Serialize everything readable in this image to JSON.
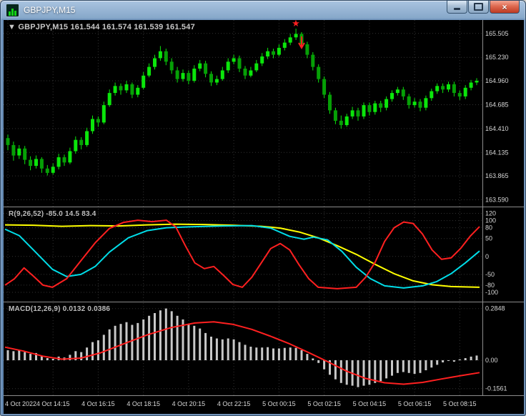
{
  "window": {
    "title": "GBPJPY,M15",
    "close_glyph": "×"
  },
  "colors": {
    "background": "#000000",
    "grid": "#333333",
    "separator": "#8c8c8c",
    "axis_text": "#d8d8d8",
    "bull": "#0be60b",
    "bear": "#06a006",
    "wick": "#0be60b",
    "marker": "#ff2020"
  },
  "chart_data": [
    {
      "type": "candlestick",
      "title": "GBPJPY,M15",
      "ohlc_label": "▼ GBPJPY,M15 161.544 161.574 161.539 161.547",
      "ylim": [
        163.52,
        165.66
      ],
      "y_ticks": [
        "165.505",
        "165.230",
        "164.960",
        "164.685",
        "164.410",
        "164.135",
        "163.865",
        "163.590"
      ],
      "x_ticks": [
        {
          "i": 0,
          "label": "4 Oct 2022"
        },
        {
          "i": 8,
          "label": "4 Oct 14:15"
        },
        {
          "i": 16,
          "label": "4 Oct 16:15"
        },
        {
          "i": 24,
          "label": "4 Oct 18:15"
        },
        {
          "i": 32,
          "label": "4 Oct 20:15"
        },
        {
          "i": 40,
          "label": "4 Oct 22:15"
        },
        {
          "i": 48,
          "label": "5 Oct 00:15"
        },
        {
          "i": 56,
          "label": "5 Oct 02:15"
        },
        {
          "i": 64,
          "label": "5 Oct 04:15"
        },
        {
          "i": 72,
          "label": "5 Oct 06:15"
        },
        {
          "i": 80,
          "label": "5 Oct 08:15"
        }
      ],
      "markers": [
        {
          "index": 51,
          "type": "star"
        },
        {
          "index": 52,
          "type": "arrow-down"
        }
      ],
      "candles": [
        [
          164.3,
          164.34,
          164.16,
          164.22
        ],
        [
          164.22,
          164.26,
          164.04,
          164.1
        ],
        [
          164.1,
          164.22,
          164.06,
          164.18
        ],
        [
          164.18,
          164.21,
          164.0,
          164.05
        ],
        [
          164.05,
          164.09,
          163.93,
          163.98
        ],
        [
          163.98,
          164.1,
          163.95,
          164.06
        ],
        [
          164.06,
          164.08,
          163.9,
          163.95
        ],
        [
          163.95,
          163.99,
          163.87,
          163.9
        ],
        [
          163.9,
          164.01,
          163.88,
          163.97
        ],
        [
          163.97,
          164.12,
          163.94,
          164.08
        ],
        [
          164.08,
          164.11,
          163.98,
          164.02
        ],
        [
          164.02,
          164.19,
          164.0,
          164.15
        ],
        [
          164.15,
          164.32,
          164.12,
          164.28
        ],
        [
          164.28,
          164.31,
          164.17,
          164.22
        ],
        [
          164.22,
          164.42,
          164.2,
          164.38
        ],
        [
          164.38,
          164.56,
          164.35,
          164.52
        ],
        [
          164.52,
          164.55,
          164.43,
          164.48
        ],
        [
          164.48,
          164.72,
          164.46,
          164.68
        ],
        [
          164.68,
          164.86,
          164.66,
          164.82
        ],
        [
          164.82,
          164.94,
          164.79,
          164.9
        ],
        [
          164.9,
          164.93,
          164.8,
          164.85
        ],
        [
          164.85,
          164.96,
          164.82,
          164.92
        ],
        [
          164.92,
          164.94,
          164.76,
          164.8
        ],
        [
          164.8,
          164.91,
          164.77,
          164.88
        ],
        [
          164.88,
          165.06,
          164.86,
          165.02
        ],
        [
          165.02,
          165.16,
          165.0,
          165.12
        ],
        [
          165.12,
          165.26,
          165.09,
          165.22
        ],
        [
          165.22,
          165.36,
          165.19,
          165.3
        ],
        [
          165.3,
          165.33,
          165.14,
          165.18
        ],
        [
          165.18,
          165.22,
          165.04,
          165.08
        ],
        [
          165.08,
          165.12,
          164.94,
          164.98
        ],
        [
          164.98,
          165.09,
          164.95,
          165.05
        ],
        [
          165.05,
          165.08,
          164.92,
          164.96
        ],
        [
          164.96,
          165.14,
          164.94,
          165.1
        ],
        [
          165.1,
          165.2,
          165.07,
          165.16
        ],
        [
          165.16,
          165.19,
          165.0,
          165.04
        ],
        [
          165.04,
          165.07,
          164.9,
          164.94
        ],
        [
          164.94,
          165.02,
          164.91,
          164.98
        ],
        [
          164.98,
          165.12,
          164.96,
          165.08
        ],
        [
          165.08,
          165.22,
          165.05,
          165.18
        ],
        [
          165.18,
          165.26,
          165.15,
          165.22
        ],
        [
          165.22,
          165.25,
          165.06,
          165.1
        ],
        [
          165.1,
          165.13,
          164.98,
          165.02
        ],
        [
          165.02,
          165.12,
          165.0,
          165.08
        ],
        [
          165.08,
          165.2,
          165.06,
          165.16
        ],
        [
          165.16,
          165.28,
          165.13,
          165.24
        ],
        [
          165.24,
          165.34,
          165.21,
          165.3
        ],
        [
          165.3,
          165.33,
          165.22,
          165.26
        ],
        [
          165.26,
          165.38,
          165.24,
          165.34
        ],
        [
          165.34,
          165.44,
          165.31,
          165.4
        ],
        [
          165.4,
          165.5,
          165.37,
          165.46
        ],
        [
          165.46,
          165.56,
          165.43,
          165.5
        ],
        [
          165.5,
          165.52,
          165.34,
          165.38
        ],
        [
          165.38,
          165.41,
          165.22,
          165.26
        ],
        [
          165.26,
          165.29,
          165.08,
          165.12
        ],
        [
          165.12,
          165.15,
          164.94,
          164.98
        ],
        [
          164.98,
          165.01,
          164.76,
          164.8
        ],
        [
          164.8,
          164.83,
          164.58,
          164.62
        ],
        [
          164.62,
          164.65,
          164.46,
          164.5
        ],
        [
          164.5,
          164.56,
          164.41,
          164.45
        ],
        [
          164.45,
          164.58,
          164.43,
          164.55
        ],
        [
          164.55,
          164.66,
          164.52,
          164.62
        ],
        [
          164.62,
          164.65,
          164.5,
          164.55
        ],
        [
          164.55,
          164.71,
          164.52,
          164.68
        ],
        [
          164.68,
          164.71,
          164.56,
          164.6
        ],
        [
          164.6,
          164.73,
          164.57,
          164.7
        ],
        [
          164.7,
          164.73,
          164.6,
          164.65
        ],
        [
          164.65,
          164.78,
          164.62,
          164.75
        ],
        [
          164.75,
          164.85,
          164.72,
          164.82
        ],
        [
          164.82,
          164.89,
          164.79,
          164.86
        ],
        [
          164.86,
          164.89,
          164.74,
          164.78
        ],
        [
          164.78,
          164.81,
          164.64,
          164.68
        ],
        [
          164.68,
          164.76,
          164.65,
          164.72
        ],
        [
          164.72,
          164.75,
          164.61,
          164.65
        ],
        [
          164.65,
          164.79,
          164.62,
          164.76
        ],
        [
          164.76,
          164.87,
          164.73,
          164.84
        ],
        [
          164.84,
          164.93,
          164.81,
          164.9
        ],
        [
          164.9,
          164.93,
          164.82,
          164.86
        ],
        [
          164.86,
          164.95,
          164.83,
          164.92
        ],
        [
          164.92,
          164.95,
          164.78,
          164.82
        ],
        [
          164.82,
          164.85,
          164.74,
          164.78
        ],
        [
          164.78,
          164.91,
          164.75,
          164.88
        ],
        [
          164.88,
          164.97,
          164.85,
          164.94
        ],
        [
          164.94,
          164.99,
          164.91,
          164.96
        ]
      ]
    },
    {
      "type": "line",
      "label": "R(9,26,52) -85.0 14.5 83.4",
      "ylim": [
        -122,
        135
      ],
      "y_ticks": [
        "120",
        "100",
        "80",
        "50",
        "0",
        "-50",
        "-80",
        "-100"
      ],
      "series": [
        {
          "name": "slow",
          "color": "#ffff00",
          "width": 2,
          "points": [
            [
              0,
              88
            ],
            [
              0.06,
              87
            ],
            [
              0.12,
              84
            ],
            [
              0.18,
              86
            ],
            [
              0.24,
              85
            ],
            [
              0.3,
              88
            ],
            [
              0.36,
              90
            ],
            [
              0.42,
              89
            ],
            [
              0.48,
              87
            ],
            [
              0.54,
              84
            ],
            [
              0.58,
              79
            ],
            [
              0.62,
              68
            ],
            [
              0.66,
              52
            ],
            [
              0.7,
              30
            ],
            [
              0.74,
              6
            ],
            [
              0.78,
              -22
            ],
            [
              0.82,
              -48
            ],
            [
              0.86,
              -68
            ],
            [
              0.9,
              -79
            ],
            [
              0.94,
              -84
            ],
            [
              1,
              -86
            ]
          ]
        },
        {
          "name": "mid",
          "color": "#00dde8",
          "width": 2,
          "points": [
            [
              0,
              76
            ],
            [
              0.03,
              58
            ],
            [
              0.06,
              18
            ],
            [
              0.1,
              -36
            ],
            [
              0.13,
              -56
            ],
            [
              0.16,
              -50
            ],
            [
              0.19,
              -28
            ],
            [
              0.22,
              12
            ],
            [
              0.26,
              52
            ],
            [
              0.3,
              72
            ],
            [
              0.34,
              80
            ],
            [
              0.4,
              83
            ],
            [
              0.46,
              85
            ],
            [
              0.52,
              86
            ],
            [
              0.56,
              79
            ],
            [
              0.6,
              56
            ],
            [
              0.63,
              48
            ],
            [
              0.65,
              54
            ],
            [
              0.68,
              46
            ],
            [
              0.71,
              14
            ],
            [
              0.74,
              -30
            ],
            [
              0.77,
              -62
            ],
            [
              0.8,
              -82
            ],
            [
              0.84,
              -88
            ],
            [
              0.88,
              -82
            ],
            [
              0.91,
              -70
            ],
            [
              0.94,
              -48
            ],
            [
              0.97,
              -18
            ],
            [
              1,
              15
            ]
          ]
        },
        {
          "name": "fast",
          "color": "#ff2020",
          "width": 2,
          "points": [
            [
              0,
              -80
            ],
            [
              0.02,
              -62
            ],
            [
              0.04,
              -32
            ],
            [
              0.06,
              -55
            ],
            [
              0.08,
              -80
            ],
            [
              0.1,
              -86
            ],
            [
              0.13,
              -62
            ],
            [
              0.16,
              -12
            ],
            [
              0.19,
              38
            ],
            [
              0.22,
              78
            ],
            [
              0.25,
              95
            ],
            [
              0.28,
              101
            ],
            [
              0.31,
              97
            ],
            [
              0.34,
              101
            ],
            [
              0.36,
              82
            ],
            [
              0.38,
              30
            ],
            [
              0.4,
              -18
            ],
            [
              0.42,
              -34
            ],
            [
              0.44,
              -28
            ],
            [
              0.46,
              -52
            ],
            [
              0.48,
              -78
            ],
            [
              0.5,
              -86
            ],
            [
              0.52,
              -58
            ],
            [
              0.54,
              -18
            ],
            [
              0.56,
              22
            ],
            [
              0.58,
              36
            ],
            [
              0.6,
              18
            ],
            [
              0.62,
              -24
            ],
            [
              0.64,
              -62
            ],
            [
              0.66,
              -86
            ],
            [
              0.7,
              -90
            ],
            [
              0.74,
              -86
            ],
            [
              0.76,
              -58
            ],
            [
              0.78,
              -16
            ],
            [
              0.8,
              42
            ],
            [
              0.82,
              80
            ],
            [
              0.84,
              96
            ],
            [
              0.86,
              92
            ],
            [
              0.88,
              62
            ],
            [
              0.9,
              18
            ],
            [
              0.92,
              -8
            ],
            [
              0.94,
              -4
            ],
            [
              0.96,
              22
            ],
            [
              0.98,
              56
            ],
            [
              1,
              83
            ]
          ]
        }
      ]
    },
    {
      "type": "macd",
      "label": "MACD(12,26,9) 0.0132 0.0386",
      "ylim": [
        -0.185,
        0.315
      ],
      "y_ticks": [
        "0.2848",
        "0.00",
        "-0.1561"
      ],
      "histogram_color": "#c8c8c8",
      "signal_color": "#ff2020",
      "histogram": [
        0.055,
        0.05,
        0.055,
        0.045,
        0.035,
        0.04,
        0.025,
        0.012,
        0.008,
        0.02,
        0.015,
        0.03,
        0.05,
        0.045,
        0.07,
        0.1,
        0.11,
        0.14,
        0.17,
        0.19,
        0.2,
        0.21,
        0.195,
        0.205,
        0.225,
        0.245,
        0.26,
        0.275,
        0.285,
        0.27,
        0.245,
        0.225,
        0.2,
        0.19,
        0.175,
        0.15,
        0.13,
        0.12,
        0.115,
        0.12,
        0.115,
        0.1,
        0.085,
        0.075,
        0.07,
        0.07,
        0.072,
        0.065,
        0.065,
        0.068,
        0.07,
        0.068,
        0.055,
        0.035,
        0.01,
        -0.015,
        -0.05,
        -0.08,
        -0.105,
        -0.125,
        -0.135,
        -0.14,
        -0.148,
        -0.14,
        -0.135,
        -0.125,
        -0.115,
        -0.1,
        -0.085,
        -0.07,
        -0.065,
        -0.07,
        -0.075,
        -0.07,
        -0.055,
        -0.04,
        -0.025,
        -0.012,
        0.0,
        -0.008,
        0.005,
        0.012,
        0.02,
        0.026
      ],
      "signal": [
        [
          0,
          0.072
        ],
        [
          0.04,
          0.05
        ],
        [
          0.08,
          0.022
        ],
        [
          0.12,
          0.006
        ],
        [
          0.16,
          0.012
        ],
        [
          0.2,
          0.04
        ],
        [
          0.25,
          0.09
        ],
        [
          0.3,
          0.14
        ],
        [
          0.35,
          0.18
        ],
        [
          0.4,
          0.205
        ],
        [
          0.44,
          0.212
        ],
        [
          0.48,
          0.198
        ],
        [
          0.52,
          0.17
        ],
        [
          0.56,
          0.132
        ],
        [
          0.6,
          0.09
        ],
        [
          0.64,
          0.042
        ],
        [
          0.68,
          -0.008
        ],
        [
          0.72,
          -0.06
        ],
        [
          0.76,
          -0.1
        ],
        [
          0.8,
          -0.124
        ],
        [
          0.84,
          -0.132
        ],
        [
          0.88,
          -0.122
        ],
        [
          0.92,
          -0.103
        ],
        [
          0.96,
          -0.085
        ],
        [
          1,
          -0.068
        ]
      ]
    }
  ]
}
